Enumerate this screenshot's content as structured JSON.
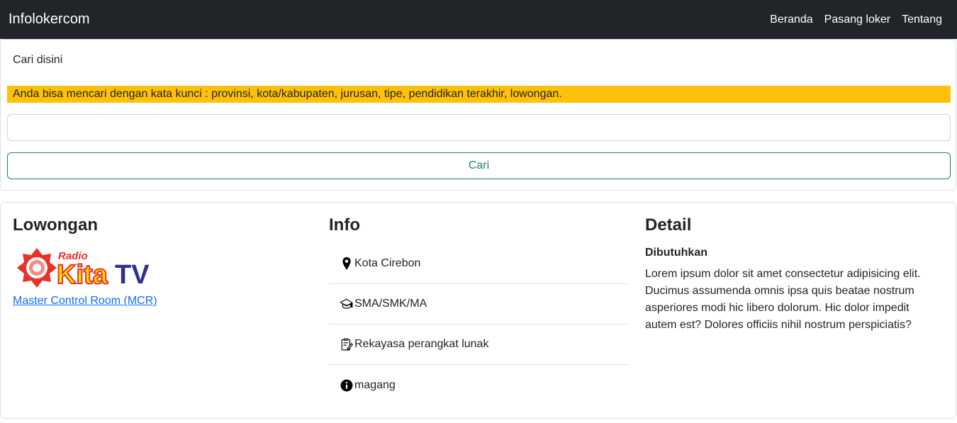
{
  "navbar": {
    "brand": "Infolokercom",
    "links": [
      "Beranda",
      "Pasang loker",
      "Tentang"
    ]
  },
  "search": {
    "title": "Cari disini",
    "alert": "Anda bisa mencari dengan kata kunci : provinsi, kota/kabupaten, jurusan, tipe, pendidikan terakhir, lowongan.",
    "input_value": "",
    "button_label": "Cari"
  },
  "lowongan": {
    "heading": "Lowongan",
    "logo_text_top": "Radio",
    "logo_text_main": "Kita",
    "logo_text_tv": "TV",
    "job_title": "Master Control Room (MCR)"
  },
  "info": {
    "heading": "Info",
    "items": [
      {
        "icon": "location-pin-icon",
        "text": "Kota Cirebon"
      },
      {
        "icon": "graduation-cap-icon",
        "text": "SMA/SMK/MA"
      },
      {
        "icon": "clipboard-edit-icon",
        "text": "Rekayasa perangkat lunak"
      },
      {
        "icon": "info-circle-icon",
        "text": "magang"
      }
    ]
  },
  "detail": {
    "heading": "Detail",
    "subheading": "Dibutuhkan",
    "description": "Lorem ipsum dolor sit amet consectetur adipisicing elit. Ducimus assumenda omnis ipsa quis beatae nostrum asperiores modi hic libero dolorum. Hic dolor impedit autem est? Dolores officiis nihil nostrum perspiciatis?"
  },
  "colors": {
    "navbar": "#212529",
    "alert": "#ffc107",
    "button": "#198754",
    "link": "#0d6efd"
  }
}
